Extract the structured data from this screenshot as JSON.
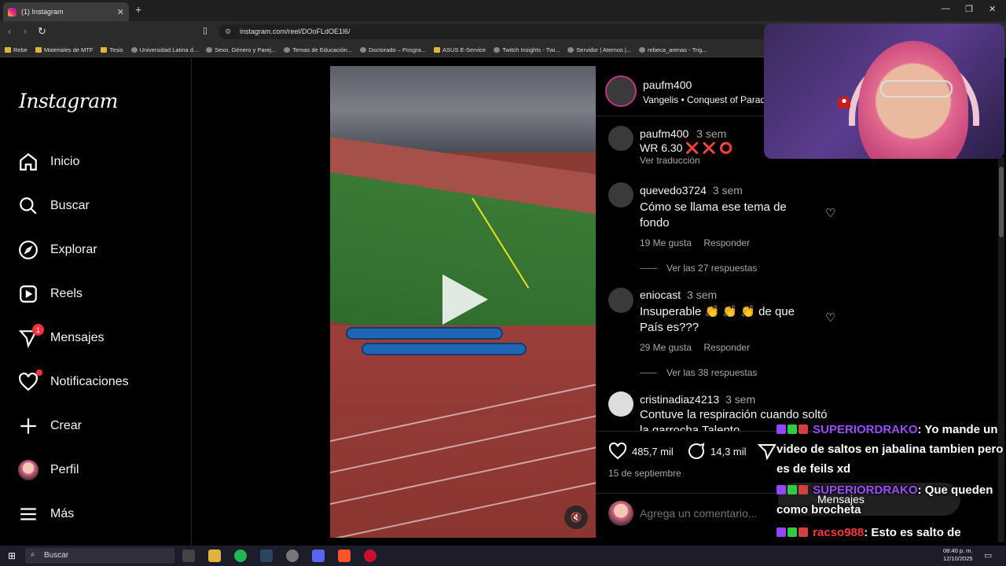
{
  "browser": {
    "tab_title": "(1) Instagram",
    "tab_close": "✕",
    "new_tab": "+",
    "url": "instagram.com/reel/DOoFLdOE1l6/",
    "bookmarks": [
      "Rebe",
      "Materiales de MTF",
      "Tesis",
      "Universidad Latina d...",
      "Sexo, Género y Parej...",
      "Temas de Educación...",
      "Doctorado – Posgra...",
      "ASUS E-Service",
      "Twitch Insights - Twi...",
      "Servidor | Aternos |...",
      "rebeca_arenas - Trig..."
    ]
  },
  "sidebar": {
    "logo": "Instagram",
    "items": [
      {
        "label": "Inicio"
      },
      {
        "label": "Buscar"
      },
      {
        "label": "Explorar"
      },
      {
        "label": "Reels"
      },
      {
        "label": "Mensajes",
        "badge": "1"
      },
      {
        "label": "Notificaciones"
      },
      {
        "label": "Crear"
      },
      {
        "label": "Perfil"
      },
      {
        "label": "Más"
      }
    ]
  },
  "post": {
    "author": "paufm400",
    "audio": "Vangelis • Conquest of Parad",
    "comments": [
      {
        "user": "paufm400",
        "time": "3 sem",
        "text": "WR 6.30 ❌ ❌ ⭕",
        "action": "Ver traducción"
      },
      {
        "user": "quevedo3724",
        "time": "3 sem",
        "text": "Cómo se llama ese tema de fondo",
        "likes": "19 Me gusta",
        "reply": "Responder",
        "view_replies": "Ver las 27 respuestas"
      },
      {
        "user": "eniocast",
        "time": "3 sem",
        "text": "Insuperable 👏 👏 👏 de que País es???",
        "likes": "29 Me gusta",
        "reply": "Responder",
        "view_replies": "Ver las 38 respuestas"
      },
      {
        "user": "cristinadiaz4213",
        "time": "3 sem",
        "text": "Contuve la respiración cuando soltó la garrocha Talento"
      }
    ],
    "like_count": "485,7 mil",
    "comment_count": "14,3 mil",
    "date": "15 de septiembre",
    "comment_placeholder": "Agrega un comentario..."
  },
  "chat": [
    {
      "nick": "SUPERIORDRAKO",
      "text": ": Yo mande un video de saltos en jabalina tambien pero es de feils xd"
    },
    {
      "nick": "SUPERIORDRAKO",
      "text": ": Que queden como brocheta"
    },
    {
      "nick": "racso988",
      "text": ": Esto es salto de garrocha"
    }
  ],
  "messages_pill": "Mensajes",
  "taskbar": {
    "search_placeholder": "Buscar",
    "time": "08:40 p. m.",
    "date": "12/10/2025"
  },
  "colors": {
    "accent_purple": "#9b4dff",
    "notification_red": "#ff3040",
    "ig_background": "#000000"
  }
}
